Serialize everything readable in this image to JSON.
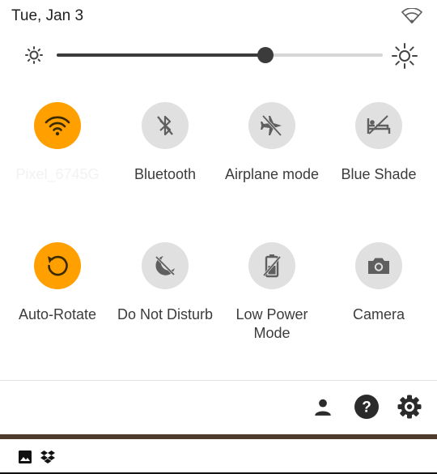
{
  "status": {
    "date": "Tue, Jan 3",
    "wifi_icon": "wifi-signal-icon"
  },
  "brightness": {
    "level_percent": 64,
    "low_icon": "brightness-low-icon",
    "high_icon": "brightness-high-icon"
  },
  "tiles": [
    {
      "label": "Pixel_6745G",
      "icon": "wifi-icon",
      "active": true
    },
    {
      "label": "Bluetooth",
      "icon": "bluetooth-off-icon",
      "active": false
    },
    {
      "label": "Airplane mode",
      "icon": "airplane-off-icon",
      "active": false
    },
    {
      "label": "Blue Shade",
      "icon": "night-light-off-icon",
      "active": false
    },
    {
      "label": "Auto-Rotate",
      "icon": "auto-rotate-icon",
      "active": true
    },
    {
      "label": "Do Not Disturb",
      "icon": "do-not-disturb-off-icon",
      "active": false
    },
    {
      "label": "Low Power Mode",
      "icon": "battery-saver-off-icon",
      "active": false
    },
    {
      "label": "Camera",
      "icon": "camera-icon",
      "active": false
    }
  ],
  "footer": {
    "user_icon": "user-icon",
    "help_icon": "help-icon",
    "settings_icon": "settings-gear-icon"
  },
  "notifications": {
    "icons": [
      "image-icon",
      "dropbox-icon"
    ]
  },
  "colors": {
    "accent": "#ffa000",
    "inactive": "#e0e0e0",
    "icon_inactive": "#5f5f5f",
    "shade_edge": "#4e3b2c"
  }
}
